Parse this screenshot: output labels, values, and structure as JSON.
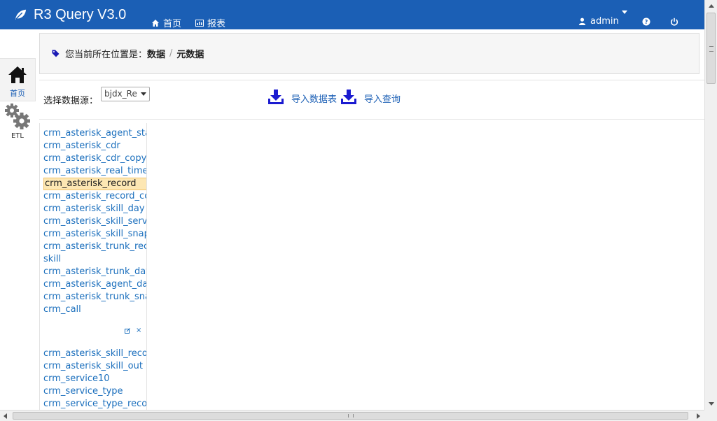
{
  "app": {
    "title": "R3 Query V3.0",
    "accent_color": "#1b5fb5",
    "nav": [
      {
        "label": "首页",
        "icon": "home-icon"
      },
      {
        "label": "报表",
        "icon": "bar-chart-icon"
      }
    ],
    "user": {
      "name": "admin",
      "icon": "user-icon"
    },
    "help_icon": "question-circle-icon",
    "power_icon": "power-icon"
  },
  "sidebar": {
    "items": [
      {
        "label": "首页",
        "icon": "home-icon",
        "active": true
      },
      {
        "label": "ETL",
        "icon": "gears-icon",
        "active": false
      }
    ]
  },
  "breadcrumb": {
    "prefix": "您当前所在位置是：",
    "items": [
      "数据",
      "元数据"
    ],
    "separator": "/"
  },
  "toolbar": {
    "datasource_label": "选择数据源：",
    "datasource_value": "bjdx_Re",
    "import_table_label": "导入数据表",
    "import_query_label": "导入查询"
  },
  "table_list": {
    "items_top": [
      "crm_asterisk_agent_status",
      "crm_asterisk_cdr",
      "crm_asterisk_cdr_copy",
      "crm_asterisk_real_time",
      "crm_asterisk_record",
      "crm_asterisk_record_copy",
      "crm_asterisk_skill_day",
      "crm_asterisk_skill_service",
      "crm_asterisk_skill_snap",
      "crm_asterisk_trunk_record",
      "skill",
      "crm_asterisk_trunk_day",
      "crm_asterisk_agent_day",
      "crm_asterisk_trunk_snap",
      "crm_call"
    ],
    "selected": "crm_asterisk_record",
    "items_bottom": [
      "crm_asterisk_skill_record",
      "crm_asterisk_skill_out",
      "crm_service10",
      "crm_service_type",
      "crm_service_type_record"
    ],
    "mini_icons": [
      "edit-icon",
      "close-icon"
    ],
    "mini_close_text": "×"
  }
}
